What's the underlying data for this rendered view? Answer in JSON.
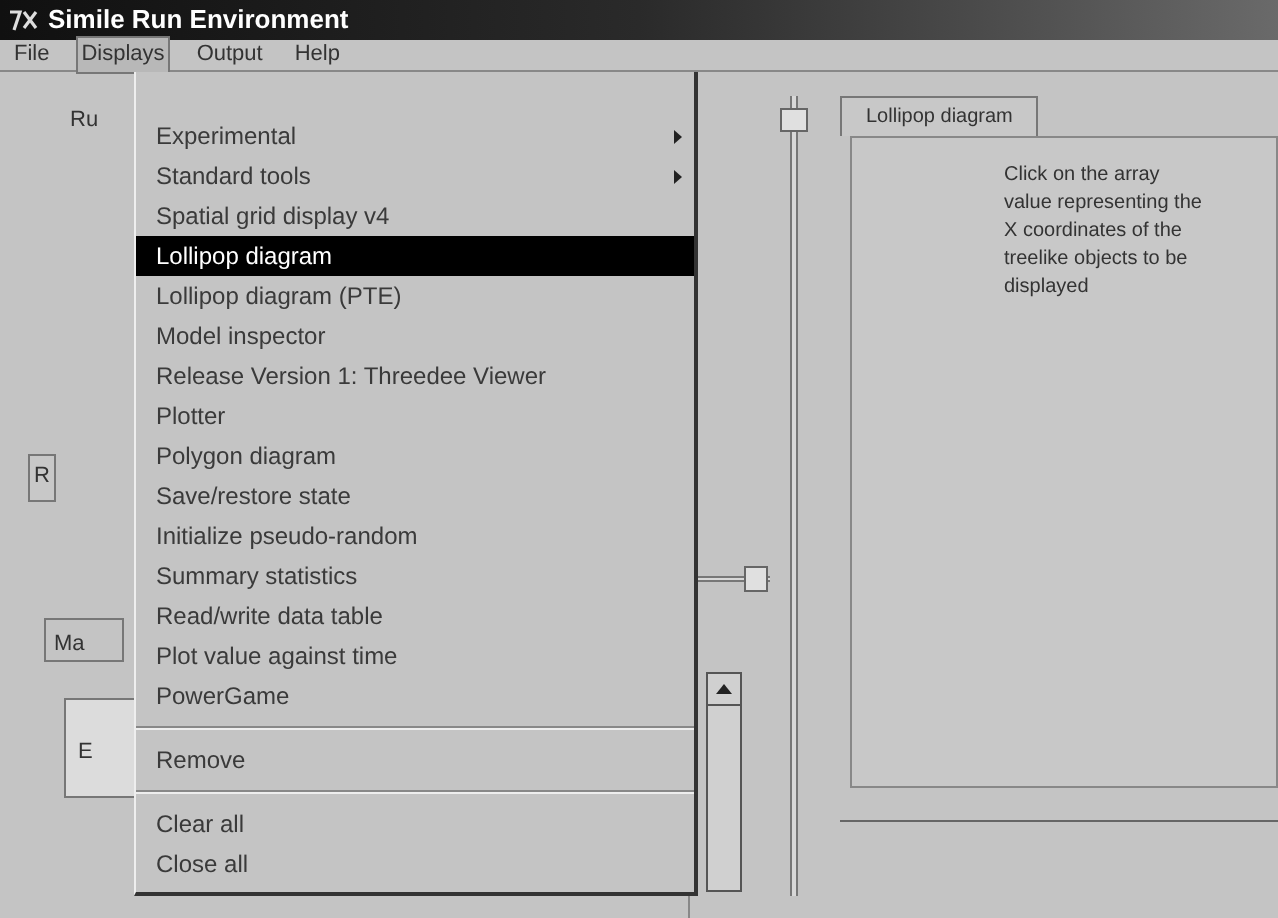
{
  "window": {
    "title": "Simile Run Environment"
  },
  "menu_bar": [
    {
      "label": "File",
      "selected": false
    },
    {
      "label": "Displays",
      "selected": true
    },
    {
      "label": "Output",
      "selected": false
    },
    {
      "label": "Help",
      "selected": false
    }
  ],
  "background_labels": [
    {
      "kind": "label",
      "text": "Ru"
    },
    {
      "kind": "button",
      "text": "R"
    },
    {
      "kind": "tab",
      "text": "Ma"
    },
    {
      "kind": "field",
      "text": "E"
    }
  ],
  "displays_menu": [
    {
      "kind": "item",
      "label": "Experimental",
      "submenu": true,
      "selected": false
    },
    {
      "kind": "item",
      "label": "Standard tools",
      "submenu": true,
      "selected": false
    },
    {
      "kind": "item",
      "label": "Spatial grid display v4",
      "submenu": false,
      "selected": false
    },
    {
      "kind": "item",
      "label": "Lollipop diagram",
      "submenu": false,
      "selected": true
    },
    {
      "kind": "item",
      "label": "Lollipop diagram (PTE)",
      "submenu": false,
      "selected": false
    },
    {
      "kind": "item",
      "label": "Model inspector",
      "submenu": false,
      "selected": false
    },
    {
      "kind": "item",
      "label": "Release Version 1: Threedee Viewer",
      "submenu": false,
      "selected": false
    },
    {
      "kind": "item",
      "label": "Plotter",
      "submenu": false,
      "selected": false
    },
    {
      "kind": "item",
      "label": "Polygon diagram",
      "submenu": false,
      "selected": false
    },
    {
      "kind": "item",
      "label": "Save/restore state",
      "submenu": false,
      "selected": false
    },
    {
      "kind": "item",
      "label": "Initialize pseudo-random",
      "submenu": false,
      "selected": false
    },
    {
      "kind": "item",
      "label": "Summary statistics",
      "submenu": false,
      "selected": false
    },
    {
      "kind": "item",
      "label": "Read/write data table",
      "submenu": false,
      "selected": false
    },
    {
      "kind": "item",
      "label": "Plot value against time",
      "submenu": false,
      "selected": false
    },
    {
      "kind": "item",
      "label": "PowerGame",
      "submenu": false,
      "selected": false
    },
    {
      "kind": "separator"
    },
    {
      "kind": "item",
      "label": "Remove",
      "submenu": false,
      "selected": false
    },
    {
      "kind": "separator"
    },
    {
      "kind": "item",
      "label": "Clear all",
      "submenu": false,
      "selected": false
    },
    {
      "kind": "item",
      "label": "Close all",
      "submenu": false,
      "selected": false
    }
  ],
  "horizontal_slider": {
    "level": 0.95
  },
  "display_tabs": [
    {
      "label": "Lollipop diagram",
      "selected": true
    }
  ],
  "display_panel": {
    "instructions": "Click on the array value representing the X coordinates of the treelike objects to be displayed"
  }
}
